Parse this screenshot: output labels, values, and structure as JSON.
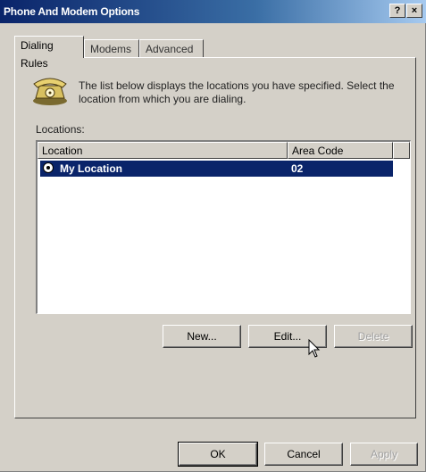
{
  "window": {
    "title": "Phone And Modem Options",
    "help_label": "?",
    "close_label": "×"
  },
  "tabs": [
    {
      "label": "Dialing Rules",
      "active": true
    },
    {
      "label": "Modems",
      "active": false
    },
    {
      "label": "Advanced",
      "active": false
    }
  ],
  "description": "The list below displays the locations you have specified. Select the location from which you are dialing.",
  "locations_label": "Locations:",
  "list": {
    "columns": [
      "Location",
      "Area Code"
    ],
    "rows": [
      {
        "location": "My Location",
        "area_code": "02",
        "selected": true
      }
    ]
  },
  "buttons": {
    "new": "New...",
    "edit": "Edit...",
    "delete": "Delete",
    "ok": "OK",
    "cancel": "Cancel",
    "apply": "Apply"
  },
  "icons": {
    "phone": "telephone-icon",
    "location": "globe-icon"
  },
  "colors": {
    "title_bar": "#0a246a",
    "selection": "#0a246a",
    "face": "#d4d0c8"
  }
}
